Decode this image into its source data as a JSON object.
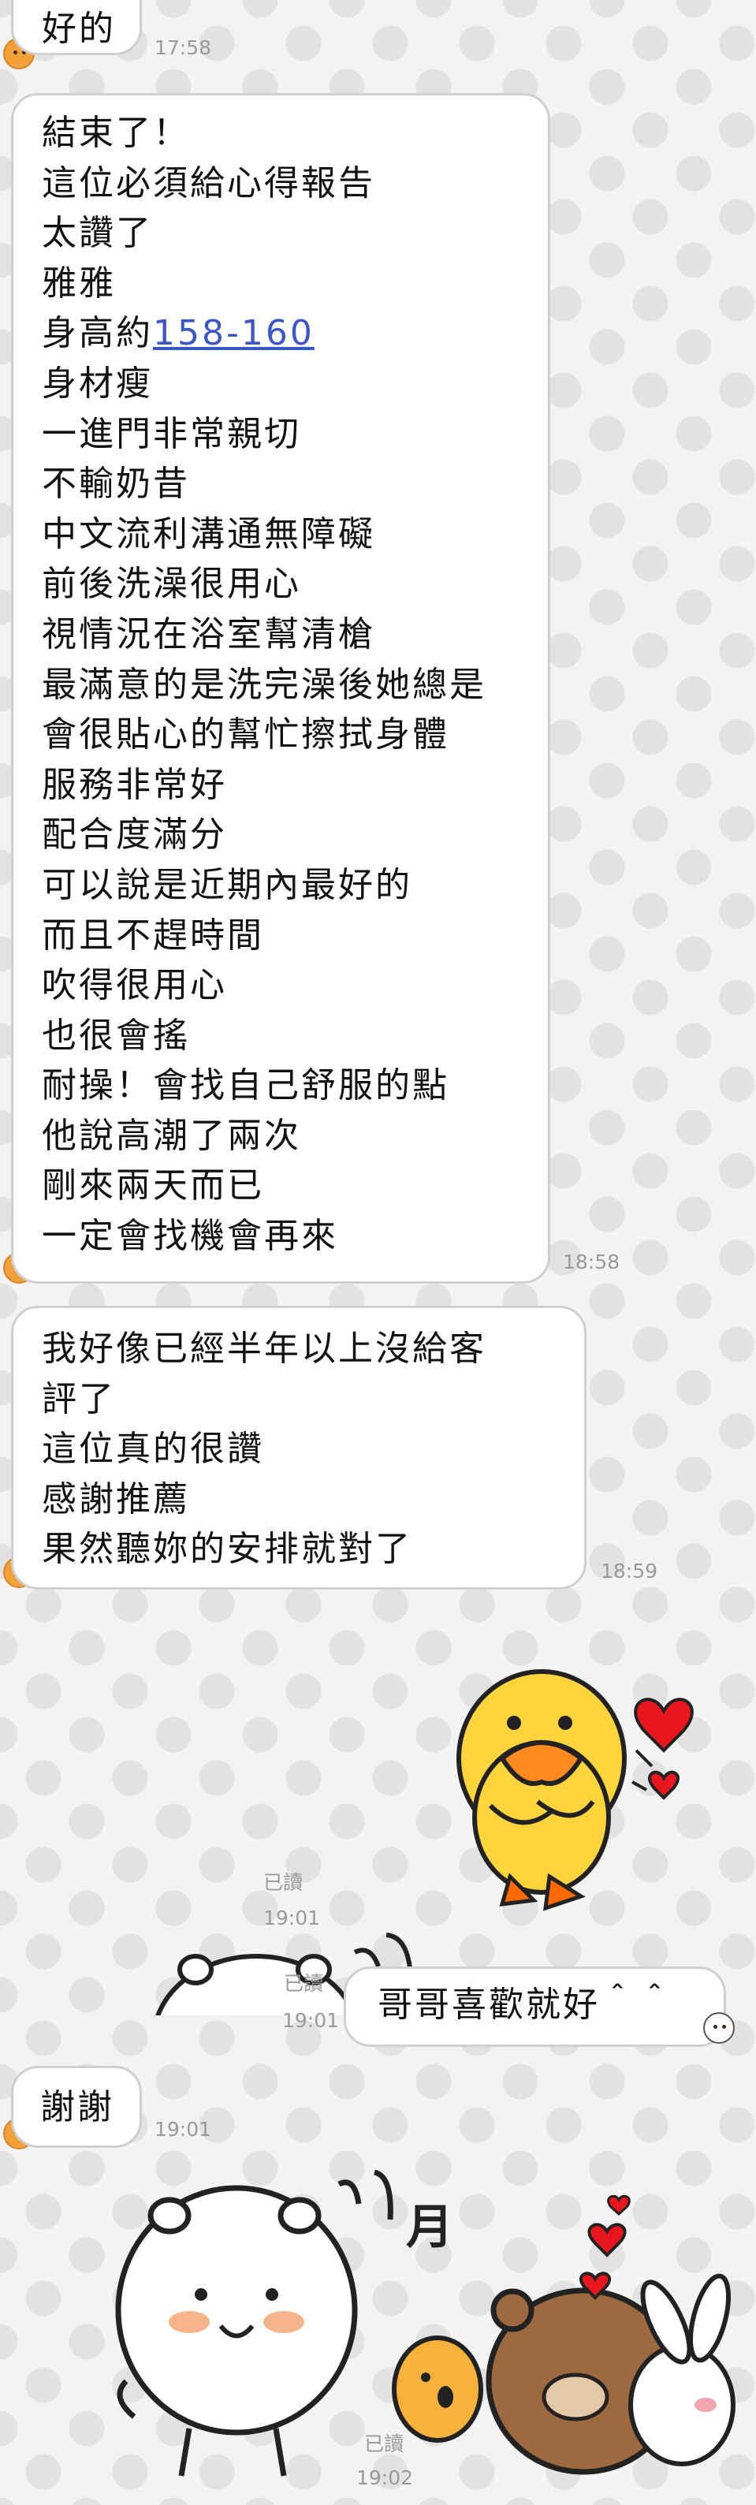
{
  "messages": {
    "m1": {
      "text": "好的",
      "time": "17:58"
    },
    "m2": {
      "lines": [
        "結束了！",
        "這位必須給心得報告",
        "太讚了",
        "雅雅",
        "身高約",
        "身材瘦",
        "一進門非常親切",
        "不輸奶昔",
        "中文流利溝通無障礙",
        "前後洗澡很用心",
        "視情況在浴室幫清槍",
        "最滿意的是洗完澡後她總是",
        "會很貼心的幫忙擦拭身體",
        "服務非常好",
        "配合度滿分",
        "可以說是近期內最好的",
        "而且不趕時間",
        "吹得很用心",
        "也很會搖",
        "耐操！會找自己舒服的點",
        "他說高潮了兩次",
        "剛來兩天而已",
        "一定會找機會再來"
      ],
      "height_link": "158-160",
      "time": "18:58"
    },
    "m3": {
      "lines": [
        "我好像已經半年以上沒給客",
        "評了",
        "這位真的很讚",
        "感謝推薦",
        "果然聽妳的安排就對了"
      ],
      "time": "18:59"
    },
    "m4": {
      "read": "已讀",
      "time": "19:01"
    },
    "m5": {
      "text": "哥哥喜歡就好＾＾",
      "read": "已讀",
      "time": "19:01"
    },
    "m6": {
      "text": "謝謝",
      "time": "19:01"
    },
    "m7": {
      "read": "已讀",
      "time": "19:02"
    }
  },
  "icons": {
    "incoming_avatar": "chick-avatar-icon",
    "outgoing_sticker_1": "sally-duck-hearts-sticker",
    "outgoing_sticker_2": "white-bear-peek-sticker",
    "outgoing_sticker_3": "bear-friends-hug-sticker"
  },
  "colors": {
    "bubble_bg": "#ffffff",
    "bubble_border": "#cfcfcf",
    "link": "#3a57c8",
    "meta_text": "#9a9a9a"
  }
}
